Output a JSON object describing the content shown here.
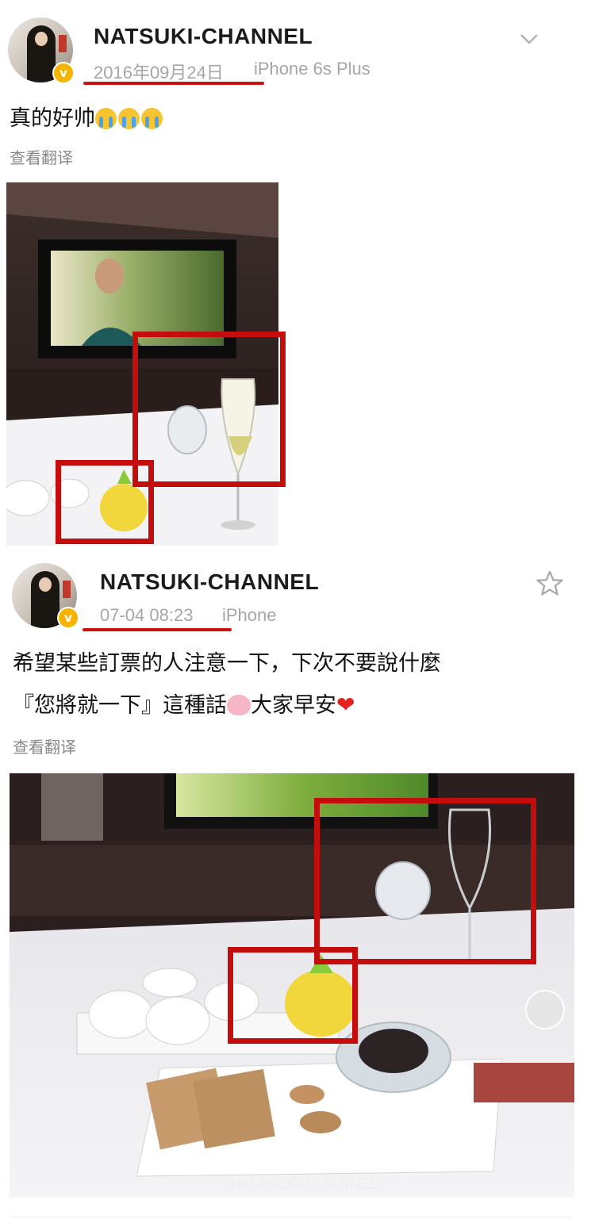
{
  "posts": [
    {
      "username": "NATSUKI-CHANNEL",
      "date": "2016年09月24日",
      "device": "iPhone 6s Plus",
      "text": "真的好帅",
      "translate": "查看翻译",
      "corner_icon": "chevron-down-icon"
    },
    {
      "username": "NATSUKI-CHANNEL",
      "date": "07-04 08:23",
      "device": "iPhone",
      "text_line1": "希望某些訂票的人注意一下，下次不要說什麼",
      "text_line2a": "『您將就一下』這種話",
      "text_line2b": "大家早安",
      "translate": "查看翻译",
      "corner_icon": "star-outline-icon",
      "watermark": "@NATSUKI-CHANNEL"
    }
  ],
  "colors": {
    "highlight_red": "#c40d0d",
    "badge": "#f6b400",
    "meta_gray": "#a6a6a6"
  }
}
